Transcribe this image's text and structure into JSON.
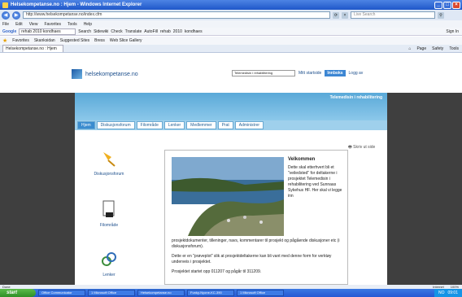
{
  "window": {
    "title": "Helsekompetanse.no : Hjem - Windows Internet Explorer"
  },
  "address": {
    "url": "http://www.helsekompetanse.no/index.cfm",
    "search_placeholder": "Live Search"
  },
  "menu": [
    "File",
    "Edit",
    "View",
    "Favorites",
    "Tools",
    "Help"
  ],
  "googlebar": {
    "logo": "Google",
    "query": "rehab 2010 kondhaes",
    "search": "Search",
    "items": [
      "Sidewiki",
      "Check",
      "Translate",
      "AutoFill",
      "rehab",
      "2010",
      "kondhaes"
    ],
    "signin": "Sign In"
  },
  "favorites": {
    "label": "Favorites",
    "items": [
      "Skanksidan",
      "Suggested Sites",
      "Bress",
      "Web Slice Gallery"
    ]
  },
  "tab": {
    "label": "Helsekompetanse.no : Hjem",
    "commands": [
      "Page",
      "Safety",
      "Tools"
    ]
  },
  "site": {
    "logo": "helsekompetanse.no",
    "selector": "Telemedisin i rehabilitering",
    "mine": "Mitt startside",
    "innboks": "Innboks",
    "login": "Logg av",
    "banner_title": "Telemedisin i rehabilitering",
    "tabs": [
      "Hjem",
      "Diskusjonsforum",
      "Filområde",
      "Lenker",
      "Medlemmer",
      "Prat",
      "Administrer"
    ],
    "print": "Skriv ut side",
    "sidelinks": [
      "Diskusjonsforum",
      "Filområde",
      "Lenker"
    ],
    "welcome_title": "Velkommen",
    "welcome_text": "Dette skal etterhvert bli et \"veiledsted\" for deltakerne i prosjektet Telemedisin i rehabilitering ved Sunnaas Sykehus HF. Her skal vi legge inn",
    "paragraphs": [
      "prosjektdokumenter, tilleninger, navs, kommentarer til prosjekt og pågående diskusjoner etc (i diskusjonsforum).",
      "Dette er en \"prøveplot\" slik at prosjektdeltakerne kan bli vant med denne form for verktøy underveis i prosjektet.",
      "Prosjektet startet opp 011207 og pågår til 311209."
    ]
  },
  "status": {
    "left": "Done",
    "zone": "Internet",
    "zoom": "100%"
  },
  "taskbar": {
    "start": "start",
    "items": [
      "Office Communicator",
      "1 Microsoft Office",
      "Helsekompetanse.no",
      "Funky-Nyone-KC-390",
      "1 Microsoft Office"
    ],
    "lang": "NO",
    "clock": "09:01"
  }
}
